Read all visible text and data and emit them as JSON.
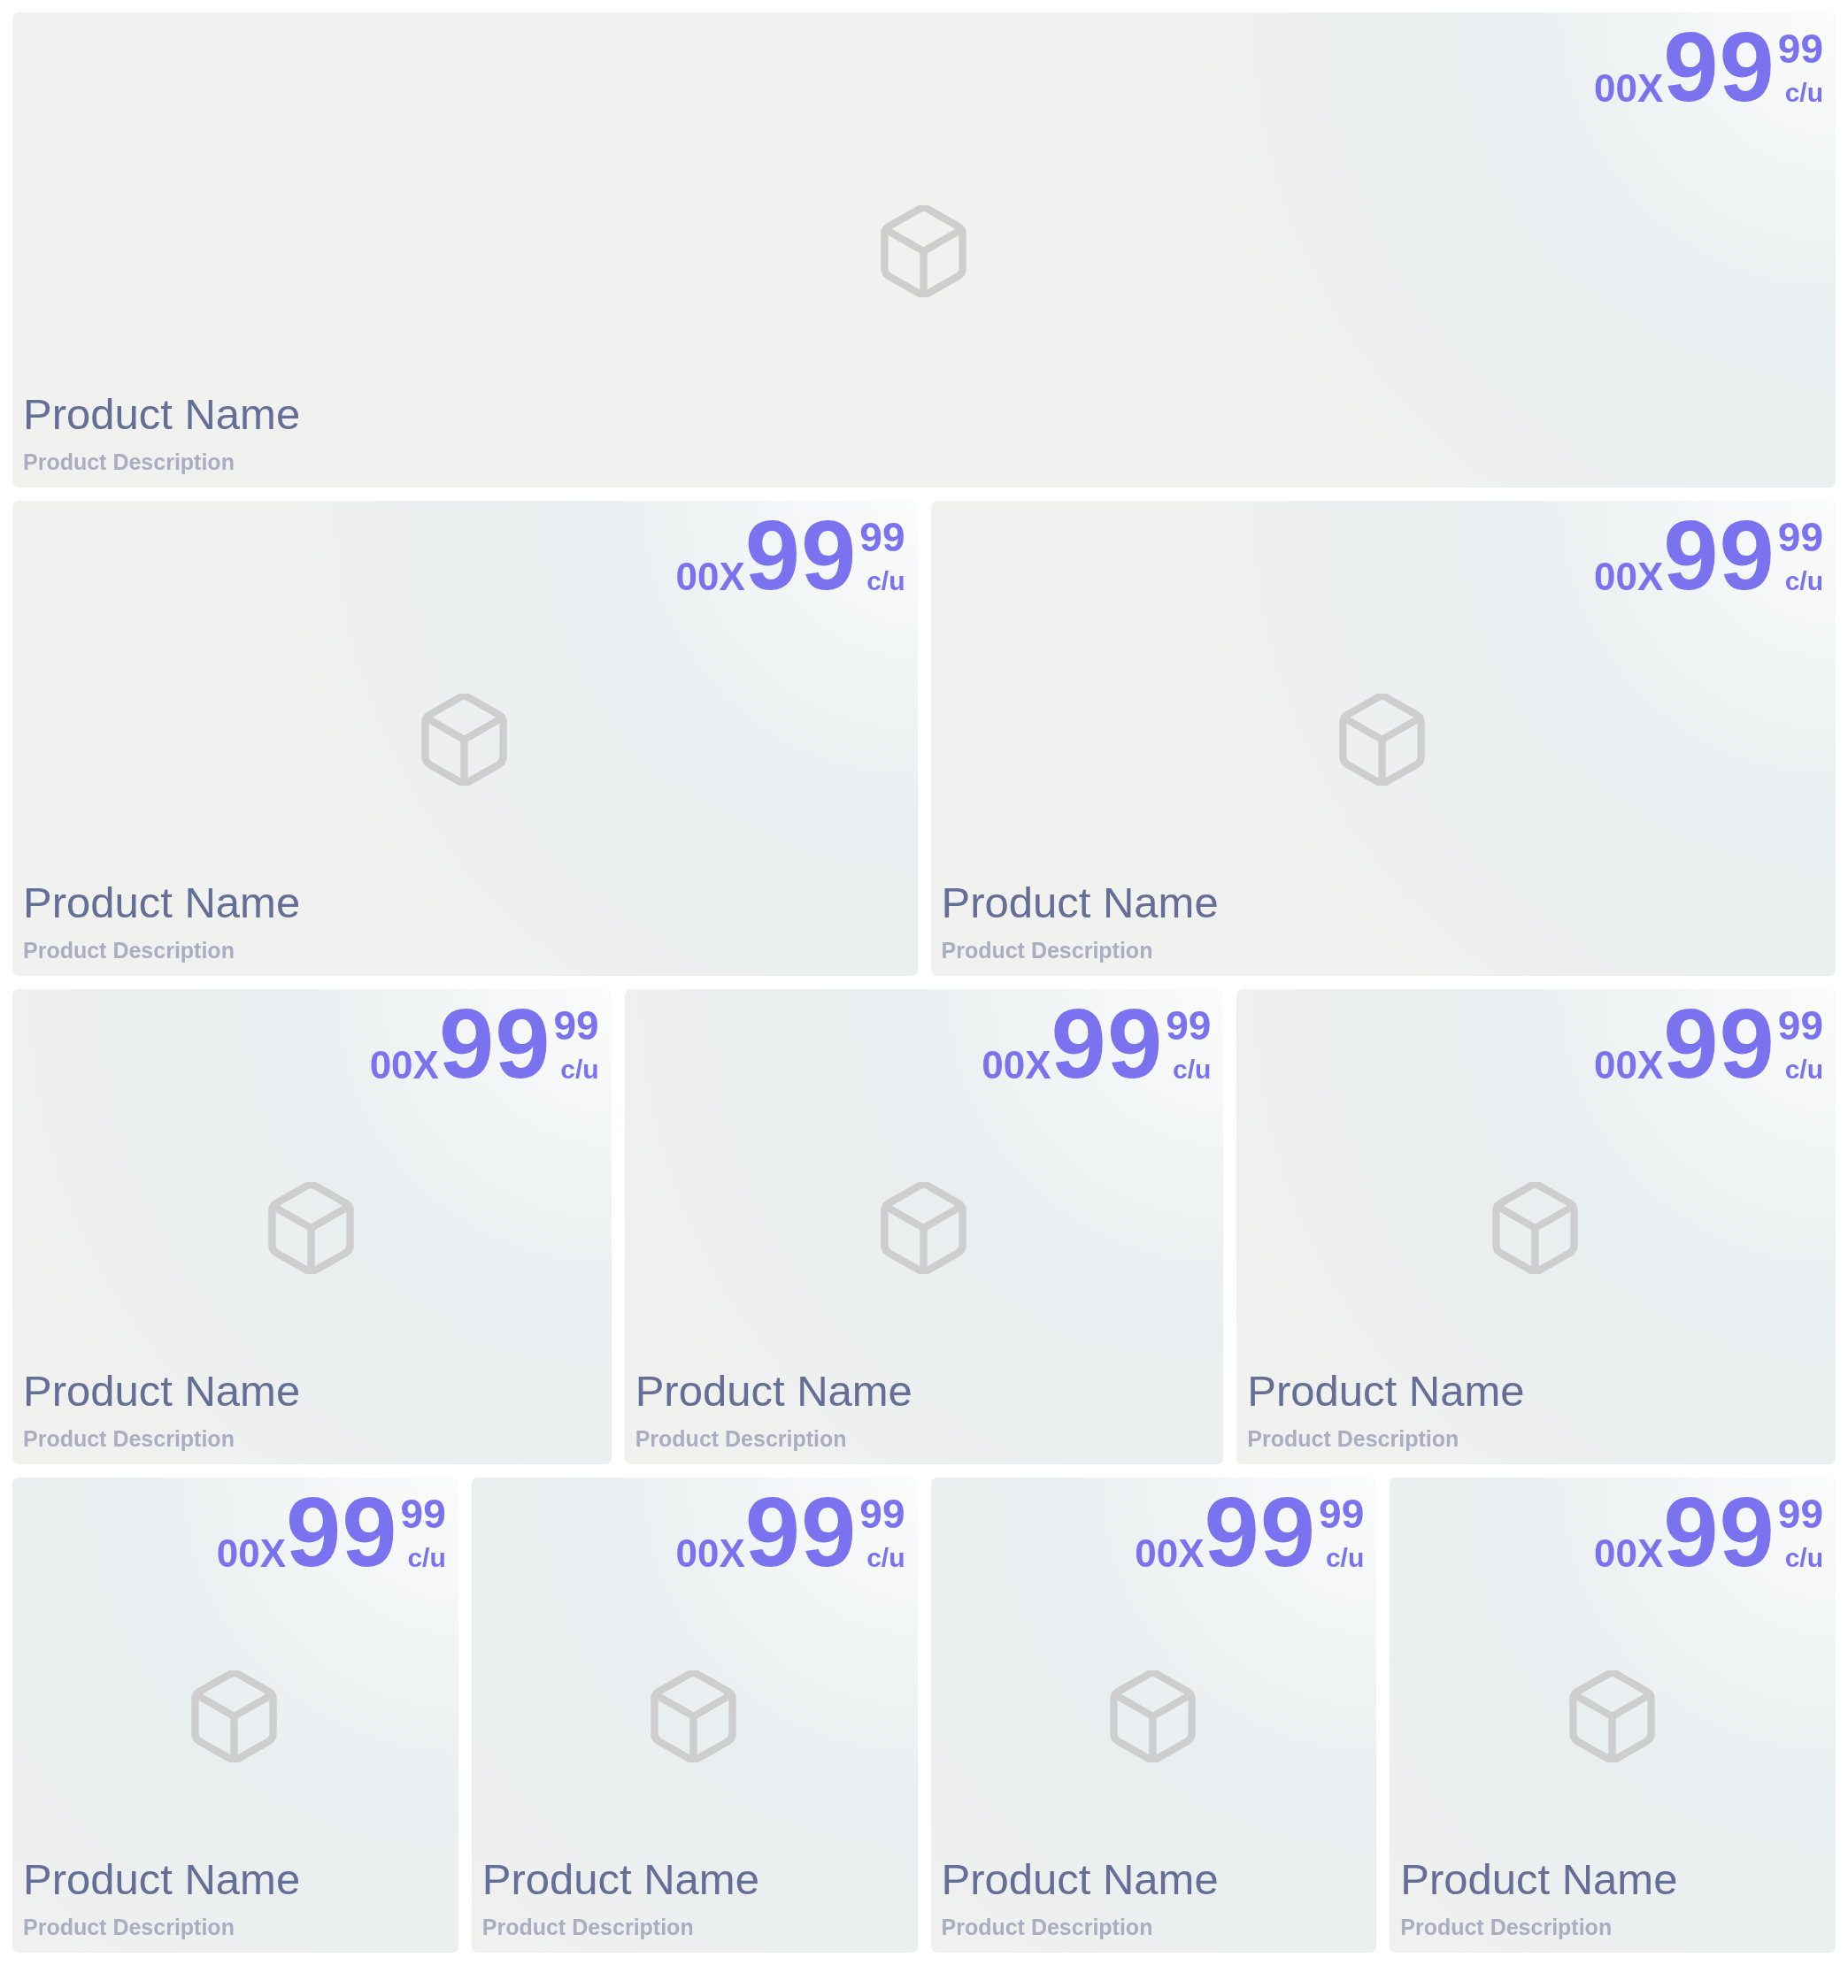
{
  "rows": [
    {
      "cards": [
        {
          "name": "Product Name",
          "description": "Product Description",
          "price": {
            "quantity": "00X",
            "whole": "99",
            "cents": "99",
            "unit": "c/u"
          }
        }
      ]
    },
    {
      "cards": [
        {
          "name": "Product Name",
          "description": "Product Description",
          "price": {
            "quantity": "00X",
            "whole": "99",
            "cents": "99",
            "unit": "c/u"
          }
        },
        {
          "name": "Product Name",
          "description": "Product Description",
          "price": {
            "quantity": "00X",
            "whole": "99",
            "cents": "99",
            "unit": "c/u"
          }
        }
      ]
    },
    {
      "cards": [
        {
          "name": "Product Name",
          "description": "Product Description",
          "price": {
            "quantity": "00X",
            "whole": "99",
            "cents": "99",
            "unit": "c/u"
          }
        },
        {
          "name": "Product Name",
          "description": "Product Description",
          "price": {
            "quantity": "00X",
            "whole": "99",
            "cents": "99",
            "unit": "c/u"
          }
        },
        {
          "name": "Product Name",
          "description": "Product Description",
          "price": {
            "quantity": "00X",
            "whole": "99",
            "cents": "99",
            "unit": "c/u"
          }
        }
      ]
    },
    {
      "cards": [
        {
          "name": "Product Name",
          "description": "Product Description",
          "price": {
            "quantity": "00X",
            "whole": "99",
            "cents": "99",
            "unit": "c/u"
          }
        },
        {
          "name": "Product Name",
          "description": "Product Description",
          "price": {
            "quantity": "00X",
            "whole": "99",
            "cents": "99",
            "unit": "c/u"
          }
        },
        {
          "name": "Product Name",
          "description": "Product Description",
          "price": {
            "quantity": "00X",
            "whole": "99",
            "cents": "99",
            "unit": "c/u"
          }
        },
        {
          "name": "Product Name",
          "description": "Product Description",
          "price": {
            "quantity": "00X",
            "whole": "99",
            "cents": "99",
            "unit": "c/u"
          }
        }
      ]
    }
  ]
}
